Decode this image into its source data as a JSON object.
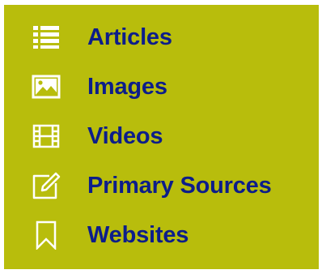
{
  "nav": {
    "items": [
      {
        "label": "Articles",
        "icon": "list-icon"
      },
      {
        "label": "Images",
        "icon": "image-icon"
      },
      {
        "label": "Videos",
        "icon": "film-icon"
      },
      {
        "label": "Primary Sources",
        "icon": "edit-icon"
      },
      {
        "label": "Websites",
        "icon": "bookmark-icon"
      }
    ]
  },
  "colors": {
    "background": "#b8bd0c",
    "label": "#0c1d8a",
    "icon": "#ffffff"
  }
}
